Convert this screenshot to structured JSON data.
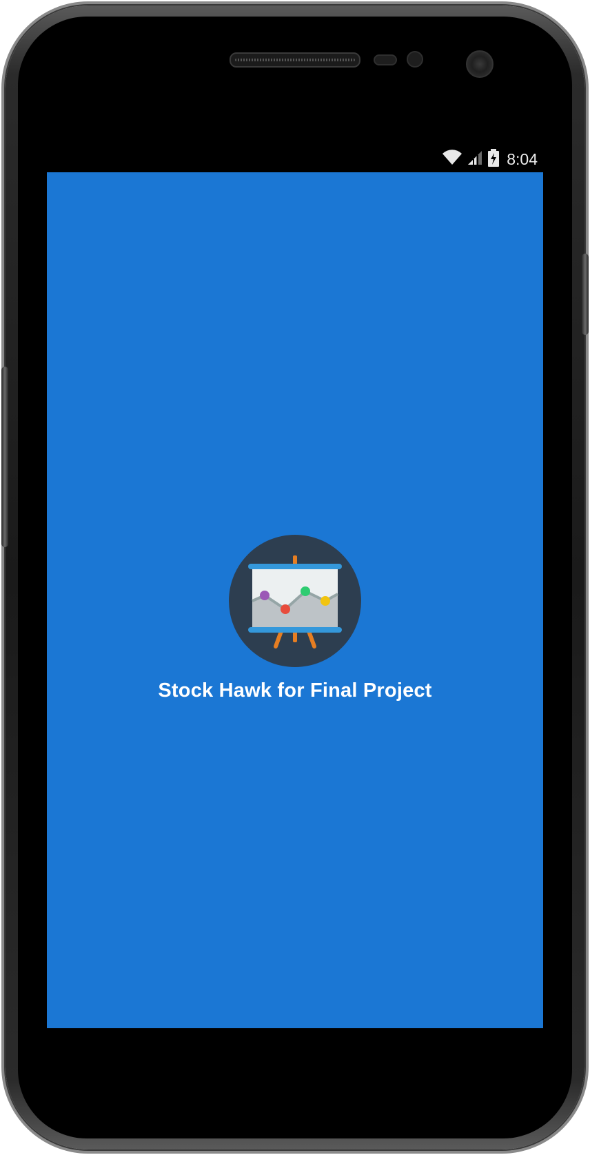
{
  "status_bar": {
    "time": "8:04",
    "icons": [
      "wifi-icon",
      "cell-signal-icon",
      "battery-charging-icon"
    ]
  },
  "splash": {
    "app_name": "Stock Hawk for Final Project",
    "logo_icon": "presentation-chart-icon"
  },
  "colors": {
    "primary": "#1b77d4",
    "logo_background": "#2d3e50",
    "status_bar": "#000000",
    "title_text": "#ffffff"
  }
}
